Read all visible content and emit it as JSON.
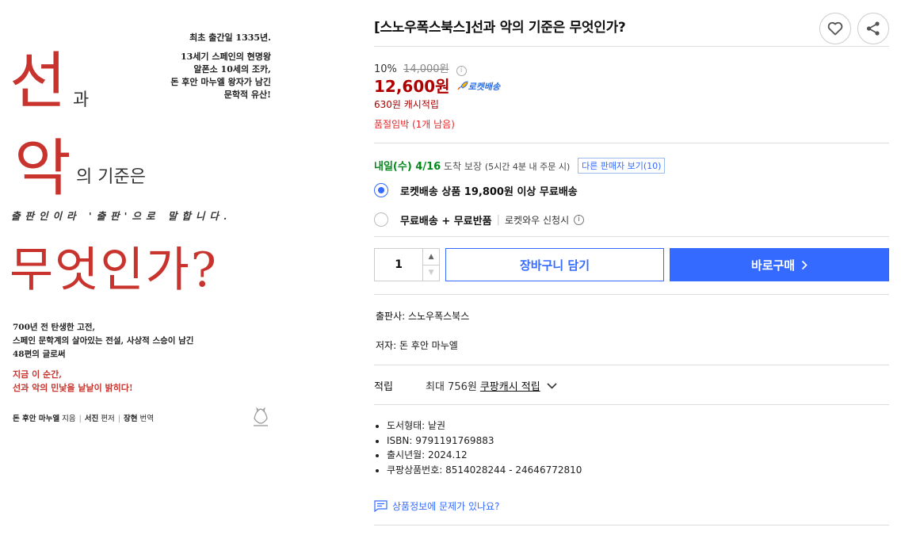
{
  "cover": {
    "title_seon": "선",
    "title_gwa": "과",
    "title_ak": "악",
    "title_gijun": "의 기준은",
    "title_mueot": "무엇인가?",
    "top_right_first": "최초 출간일 1335년.",
    "top_right_lines": [
      "13세기 스페인의 현명왕",
      "알폰소 10세의 조카,",
      "돈 후안 마누엘 왕자가 남긴",
      "문학적 유산!"
    ],
    "slogan": "출판인이라 '출판'으로 말합니다.",
    "desc_lines": [
      "700년 전 탄생한 고전,",
      "스페인 문학계의 살아있는 전설, 사상적 스승이 남긴",
      "48편의 글로써"
    ],
    "desc_red_lines": [
      "지금 이 순간,",
      "선과 악의 민낯을 낱낱이 밝히다!"
    ],
    "author_name": "돈 후안 마누엘",
    "author_role": "지음",
    "editor_name": "서진",
    "editor_role": "편저",
    "translator_name": "장현",
    "translator_role": "번역"
  },
  "product": {
    "title": "[스노우폭스북스]선과 악의 기준은 무엇인가?",
    "discount_rate": "10%",
    "original_price": "14,000원",
    "sale_price": "12,600원",
    "rocket_label": "로켓배송",
    "cash_reward": "630원 캐시적립",
    "stock_warning": "품절임박 (1개 남음)"
  },
  "delivery": {
    "arrival_date": "내일(수) 4/16",
    "arrival_guarantee": "도착 보장",
    "arrival_condition": "(5시간 4분 내 주문 시)",
    "other_sellers": "다른 판매자 보기(10)",
    "option1_label": "로켓배송 상품 19,800원 이상 무료배송",
    "option2_label": "무료배송 + 무료반품",
    "option2_sub": "로켓와우 신청시",
    "selected_option": 1
  },
  "purchase": {
    "quantity": "1",
    "cart_label": "장바구니 담기",
    "buy_label": "바로구매"
  },
  "meta": {
    "publisher": "출판사: 스노우폭스북스",
    "author": "저자: 돈 후안 마누엘"
  },
  "cash_info": {
    "label": "적립",
    "max_text": "최대 756원",
    "link_text": "쿠팡캐시 적립"
  },
  "details": [
    "도서형태: 낱권",
    "ISBN: 9791191769883",
    "출시년월: 2024.12",
    "쿠팡상품번호: 8514028244 - 24646772810"
  ],
  "report_text": "상품정보에 문제가 있나요?",
  "colors": {
    "brand_blue": "#346aff",
    "price_red": "#ae0000",
    "stock_red": "#e52528",
    "arrival_green": "#00891a",
    "cover_red": "#c8342d"
  }
}
